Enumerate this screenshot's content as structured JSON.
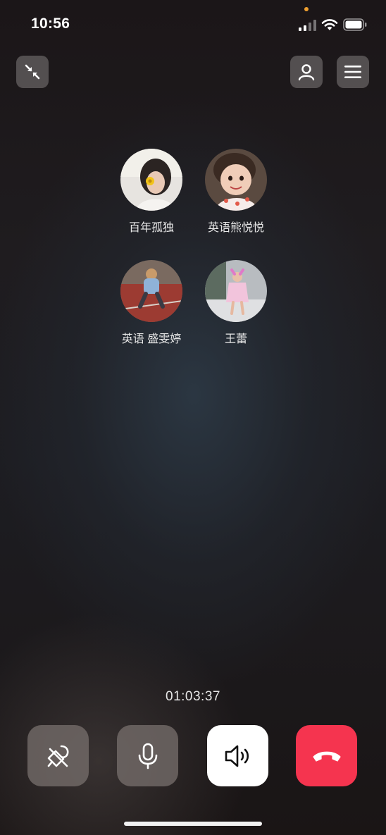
{
  "status_bar": {
    "time": "10:56",
    "signal_icon": "cellular-signal-icon",
    "wifi_icon": "wifi-icon",
    "battery_icon": "battery-icon",
    "privacy_dot_color": "#f0a030"
  },
  "top_bar": {
    "minimize_icon": "minimize-arrows-icon",
    "add_member_icon": "person-icon",
    "menu_icon": "hamburger-menu-icon"
  },
  "participants": [
    {
      "name": "百年孤独"
    },
    {
      "name": "英语熊悦悦"
    },
    {
      "name": "英语 盛雯婷"
    },
    {
      "name": "王蕾"
    }
  ],
  "call": {
    "duration": "01:03:37"
  },
  "controls": {
    "video_off_icon": "camera-off-icon",
    "mic_icon": "microphone-icon",
    "speaker_icon": "speaker-icon",
    "hangup_icon": "hang-up-icon",
    "speaker_active": true,
    "hangup_color": "#f5344f"
  }
}
